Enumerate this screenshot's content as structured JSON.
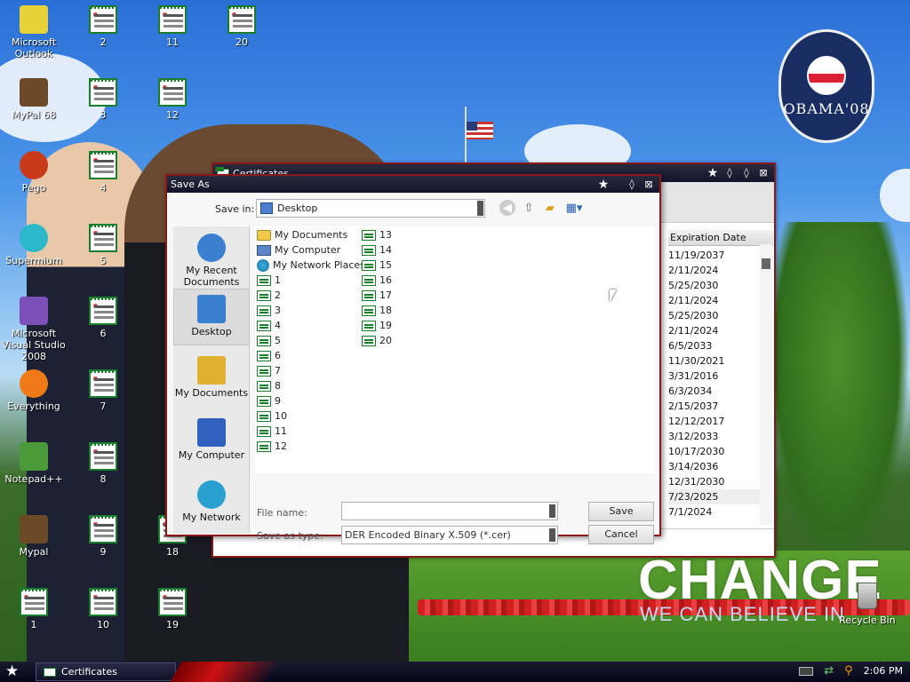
{
  "desktop": {
    "icons": [
      {
        "label": "Microsoft Outlook",
        "icon": "outlook-icon",
        "col": 0,
        "row": 0
      },
      {
        "label": "MyPal 68",
        "icon": "mypal-icon",
        "col": 0,
        "row": 1
      },
      {
        "label": "Pego",
        "icon": "pego-icon",
        "col": 0,
        "row": 2
      },
      {
        "label": "Supermium",
        "icon": "supermium-icon",
        "col": 0,
        "row": 3
      },
      {
        "label": "Microsoft Visual Studio 2008",
        "icon": "visual-studio-icon",
        "col": 0,
        "row": 4
      },
      {
        "label": "Everything",
        "icon": "everything-icon",
        "col": 0,
        "row": 5
      },
      {
        "label": "Notepad++",
        "icon": "notepadpp-icon",
        "col": 0,
        "row": 6
      },
      {
        "label": "Mypal",
        "icon": "mypal-icon",
        "col": 0,
        "row": 7
      },
      {
        "label": "1",
        "icon": "certificate-icon",
        "col": 0,
        "row": 8
      },
      {
        "label": "2",
        "icon": "certificate-icon",
        "col": 1,
        "row": 0
      },
      {
        "label": "3",
        "icon": "certificate-icon",
        "col": 1,
        "row": 1
      },
      {
        "label": "4",
        "icon": "certificate-icon",
        "col": 1,
        "row": 2
      },
      {
        "label": "5",
        "icon": "certificate-icon",
        "col": 1,
        "row": 3
      },
      {
        "label": "6",
        "icon": "certificate-icon",
        "col": 1,
        "row": 4
      },
      {
        "label": "7",
        "icon": "certificate-icon",
        "col": 1,
        "row": 5
      },
      {
        "label": "8",
        "icon": "certificate-icon",
        "col": 1,
        "row": 6
      },
      {
        "label": "9",
        "icon": "certificate-icon",
        "col": 1,
        "row": 7
      },
      {
        "label": "10",
        "icon": "certificate-icon",
        "col": 1,
        "row": 8
      },
      {
        "label": "11",
        "icon": "certificate-icon",
        "col": 2,
        "row": 0
      },
      {
        "label": "12",
        "icon": "certificate-icon",
        "col": 2,
        "row": 1
      },
      {
        "label": "18",
        "icon": "certificate-icon",
        "col": 2,
        "row": 7
      },
      {
        "label": "19",
        "icon": "certificate-icon",
        "col": 2,
        "row": 8
      },
      {
        "label": "20",
        "icon": "certificate-icon",
        "col": 3,
        "row": 0
      }
    ],
    "recycle_bin": "Recycle Bin",
    "wallpaper": {
      "logo_text": "OBAMA'08",
      "headline": "CHANGE",
      "tagline": "WE CAN BELIEVE IN"
    }
  },
  "certificates_window": {
    "title": "Certificates",
    "column_header": "Expiration Date",
    "expiration_dates": [
      "11/19/2037",
      "2/11/2024",
      "5/25/2030",
      "2/11/2024",
      "5/25/2030",
      "2/11/2024",
      "6/5/2033",
      "11/30/2021",
      "3/31/2016",
      "6/3/2034",
      "2/15/2037",
      "12/12/2017",
      "3/12/2033",
      "10/17/2030",
      "3/14/2036",
      "12/31/2030",
      "7/23/2025",
      "7/1/2024"
    ],
    "selected_row_index": 16
  },
  "save_as_dialog": {
    "title": "Save As",
    "save_in_label": "Save in:",
    "save_in_value": "Desktop",
    "places": [
      {
        "label": "My Recent Documents",
        "icon": "recent-documents-icon",
        "selected": false
      },
      {
        "label": "Desktop",
        "icon": "desktop-icon",
        "selected": true
      },
      {
        "label": "My Documents",
        "icon": "my-documents-icon",
        "selected": false
      },
      {
        "label": "My Computer",
        "icon": "my-computer-icon",
        "selected": false
      },
      {
        "label": "My Network",
        "icon": "my-network-icon",
        "selected": false
      }
    ],
    "files_col1": [
      {
        "name": "My Documents",
        "type": "folder"
      },
      {
        "name": "My Computer",
        "type": "comp"
      },
      {
        "name": "My Network Places",
        "type": "net"
      },
      {
        "name": "1",
        "type": "cert"
      },
      {
        "name": "2",
        "type": "cert"
      },
      {
        "name": "3",
        "type": "cert"
      },
      {
        "name": "4",
        "type": "cert"
      },
      {
        "name": "5",
        "type": "cert"
      },
      {
        "name": "6",
        "type": "cert"
      },
      {
        "name": "7",
        "type": "cert"
      },
      {
        "name": "8",
        "type": "cert"
      },
      {
        "name": "9",
        "type": "cert"
      },
      {
        "name": "10",
        "type": "cert"
      },
      {
        "name": "11",
        "type": "cert"
      },
      {
        "name": "12",
        "type": "cert"
      }
    ],
    "files_col2": [
      {
        "name": "13",
        "type": "cert"
      },
      {
        "name": "14",
        "type": "cert"
      },
      {
        "name": "15",
        "type": "cert"
      },
      {
        "name": "16",
        "type": "cert"
      },
      {
        "name": "17",
        "type": "cert"
      },
      {
        "name": "18",
        "type": "cert"
      },
      {
        "name": "19",
        "type": "cert"
      },
      {
        "name": "20",
        "type": "cert"
      }
    ],
    "file_name_label": "File name:",
    "file_name_value": "",
    "save_as_type_label": "Save as type:",
    "save_as_type_value": "DER Encoded Binary X.509 (*.cer)",
    "save_button": "Save",
    "cancel_button": "Cancel"
  },
  "taskbar": {
    "task_label": "Certificates",
    "clock": "2:06 PM"
  },
  "colors": {
    "window_border": "#8a1818",
    "title_bar": "#14142a",
    "taskbar": "#06061a",
    "certificate_green": "#1a7f2c"
  }
}
